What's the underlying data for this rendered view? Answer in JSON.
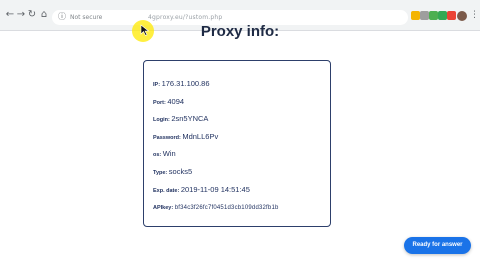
{
  "browser": {
    "status_text": "Not secure",
    "url_text": "4gproxy.eu/?ustom.php",
    "icons": {
      "back": "arrow-left-icon",
      "forward": "arrow-right-icon",
      "reload": "reload-icon",
      "home": "home-icon",
      "site_info": "info-icon",
      "menu": "kebab-menu-icon"
    },
    "extension_colors": [
      "#f4b400",
      "#9e9e9e",
      "#4caf50",
      "#34a853",
      "#0f9d58",
      "#ea4335",
      "#5f6368"
    ]
  },
  "page": {
    "title": "Proxy info:",
    "rows": [
      {
        "label": "IP:",
        "value": "176.31.100.86"
      },
      {
        "label": "Port:",
        "value": "4094"
      },
      {
        "label": "Login:",
        "value": "2sn5YNCA"
      },
      {
        "label": "Password:",
        "value": "MdnLL6Pv"
      },
      {
        "label": "os:",
        "value": "Win"
      },
      {
        "label": "Type:",
        "value": "socks5"
      },
      {
        "label": "Exp. date:",
        "value": "2019-11-09 14:51:45"
      },
      {
        "label": "APIkey:",
        "value": "bf34c3f26fc7f0451d3cb109dd32fb1b"
      }
    ],
    "cta_label": "Ready for answer",
    "accent_color": "#1a73e8",
    "text_color": "#1e2f5e"
  }
}
